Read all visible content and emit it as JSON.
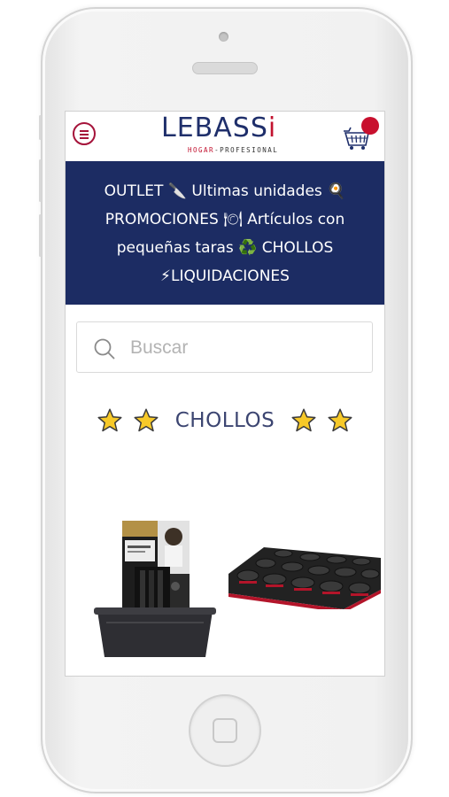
{
  "brand": {
    "logo_main": "LEBASS",
    "logo_accent": "i",
    "logo_tag_red": "HOGAR",
    "logo_tag_rest": "-PROFESIONAL"
  },
  "header": {
    "menu_icon": "hamburger-menu-icon",
    "cart_icon": "shopping-basket-icon"
  },
  "banner": {
    "text": "OUTLET 🔪 Ultimas unidades 🍳 PROMOCIONES 🍽 Artículos con pequeñas taras ♻️ CHOLLOS ⚡LIQUIDACIONES"
  },
  "search": {
    "placeholder": "Buscar",
    "value": ""
  },
  "section": {
    "title": "CHOLLOS",
    "decoration_icon": "star-icon"
  },
  "products": [
    {
      "name": "knife-block-with-slicer-set",
      "icon": "knife-block-product-image"
    },
    {
      "name": "muffin-baking-tray",
      "icon": "muffin-tray-product-image"
    }
  ],
  "colors": {
    "primary_navy": "#1c2c63",
    "accent_red": "#c8102e",
    "star_yellow": "#f7c928"
  }
}
